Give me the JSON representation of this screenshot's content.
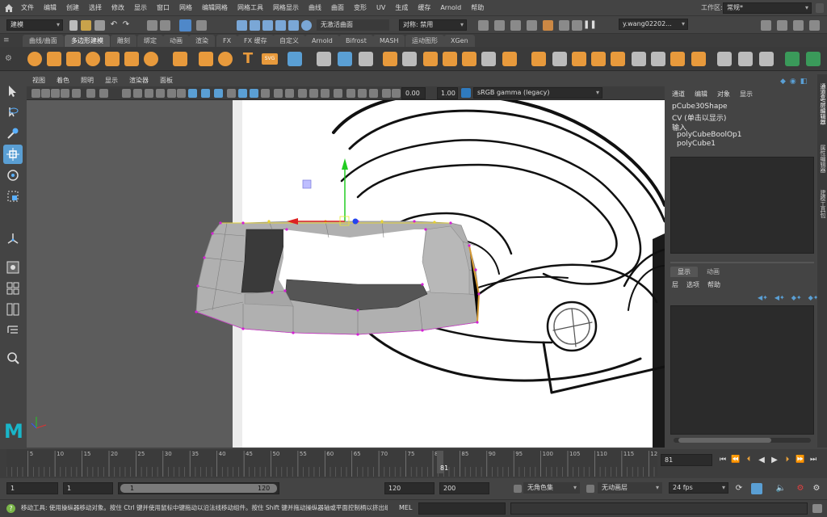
{
  "menubar": {
    "items": [
      "文件",
      "编辑",
      "创建",
      "选择",
      "修改",
      "显示",
      "窗口",
      "网格",
      "编辑网格",
      "网格工具",
      "网格显示",
      "曲线",
      "曲面",
      "变形",
      "UV",
      "生成",
      "缓存",
      "Arnold",
      "帮助"
    ],
    "workspace_label": "工作区:",
    "workspace_value": "常规*"
  },
  "statusline": {
    "mode_value": "建模",
    "live_surface": "无激活曲面",
    "symmetry": "对称: 禁用",
    "user": "y.wang02202..."
  },
  "shelf": {
    "tabs": [
      "曲线/曲面",
      "多边形建模",
      "雕刻",
      "绑定",
      "动画",
      "渲染",
      "FX",
      "FX 缓存",
      "自定义",
      "Arnold",
      "Bifrost",
      "MASH",
      "运动图形",
      "XGen"
    ],
    "active_tab": "多边形建模",
    "text_tool": "T",
    "svg_tool": "SVG"
  },
  "panel": {
    "menus": [
      "视图",
      "着色",
      "照明",
      "显示",
      "渲染器",
      "面板"
    ],
    "exposure": "0.00",
    "gamma": "1.00",
    "color_space": "sRGB gamma (legacy)"
  },
  "channelbox": {
    "menus": [
      "通道",
      "编辑",
      "对象",
      "显示"
    ],
    "shape_name": "pCube30Shape",
    "cv_label": "CV (单击以显示)",
    "inputs_label": "输入",
    "inputs": [
      "polyCubeBoolOp1",
      "polyCube1"
    ],
    "layer_tabs": [
      "显示",
      "动画"
    ],
    "layer_menus": [
      "层",
      "选项",
      "帮助"
    ],
    "side_tabs": [
      "通道盒/层编辑器",
      "属性编辑器",
      "建模工具包"
    ]
  },
  "timeline": {
    "ticks": [
      "5",
      "10",
      "15",
      "20",
      "25",
      "30",
      "35",
      "40",
      "45",
      "50",
      "55",
      "60",
      "65",
      "70",
      "75",
      "80",
      "85",
      "90",
      "95",
      "100",
      "105",
      "110",
      "115",
      "12"
    ],
    "current_marker": "81",
    "current_frame": "81"
  },
  "rangebar": {
    "start_frame": "1",
    "range_start": "1",
    "slider_start": "1",
    "slider_end": "120",
    "range_end": "120",
    "end_frame": "200",
    "character_set": "无角色集",
    "anim_layer": "无动画层",
    "fps": "24 fps"
  },
  "helpline": {
    "help_text": "移动工具: 使用操纵器移动对象。按住 Ctrl 键并使用鼠标中键拖动以沿法线移动组件。按住 Shift 键并拖动操纵器轴或平面控制柄以挤出组件或",
    "mel_label": "MEL"
  },
  "logo": "M",
  "colors": {
    "accent_blue": "#5a9fd4",
    "shelf_orange": "#e89a3c",
    "mesh_gray": "#b0b0b0",
    "manip_green": "#22cc22",
    "manip_red": "#dd2222",
    "manip_blue": "#2244ee",
    "selected_vertex": "#d41fd4"
  }
}
